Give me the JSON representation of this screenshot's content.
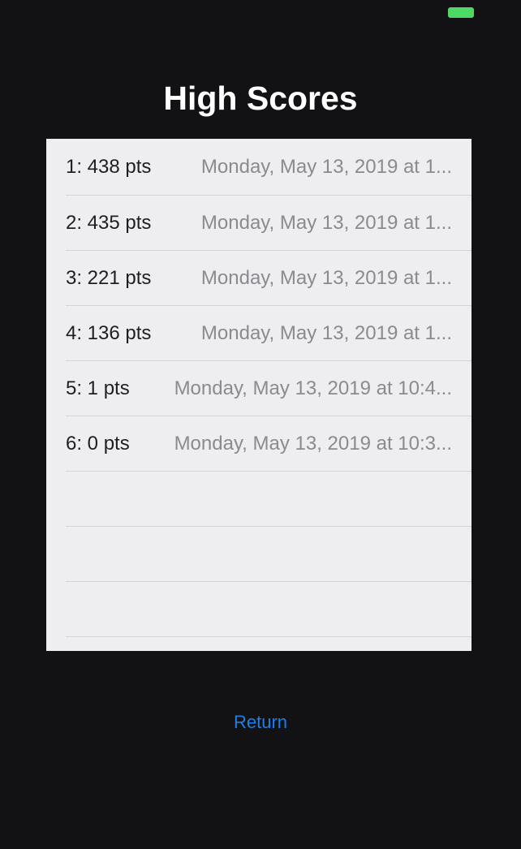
{
  "status_bar": {
    "battery_color": "#4cd964"
  },
  "title": "High Scores",
  "scores": [
    {
      "score": "1: 438 pts",
      "date": "Monday, May 13, 2019 at 1..."
    },
    {
      "score": "2: 435 pts",
      "date": "Monday, May 13, 2019 at 1..."
    },
    {
      "score": "3: 221 pts",
      "date": "Monday, May 13, 2019 at 1..."
    },
    {
      "score": "4: 136 pts",
      "date": "Monday, May 13, 2019 at 1..."
    },
    {
      "score": "5: 1 pts",
      "date": "Monday, May 13, 2019 at 10:4..."
    },
    {
      "score": "6: 0 pts",
      "date": "Monday, May 13, 2019 at 10:3..."
    }
  ],
  "return_label": "Return",
  "colors": {
    "background": "#121114",
    "table_background": "#eeedf0",
    "accent": "#1a7fe6"
  }
}
